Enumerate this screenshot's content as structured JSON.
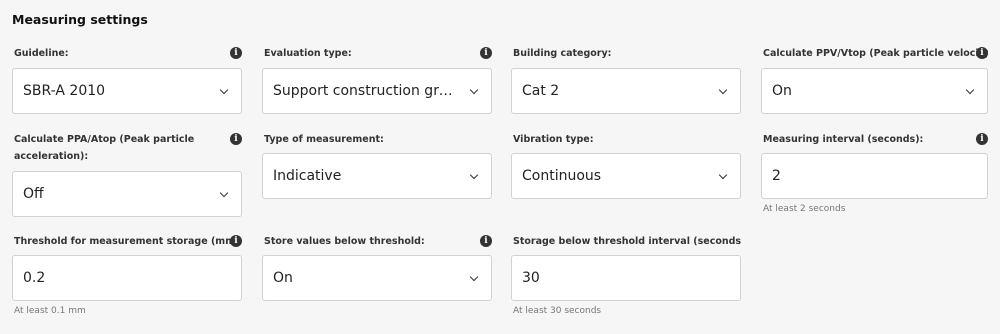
{
  "section_title": "Measuring settings",
  "fields": {
    "guideline": {
      "label": "Guideline:",
      "value": "SBR-A 2010",
      "info": "i"
    },
    "evaluation_type": {
      "label": "Evaluation type:",
      "value": "Support construction gro...",
      "info": "i"
    },
    "building_category": {
      "label": "Building category:",
      "value": "Cat 2"
    },
    "calc_ppv": {
      "label": "Calculate PPV/Vtop (Peak particle velocity",
      "value": "On",
      "info": "i"
    },
    "calc_ppa": {
      "label": "Calculate PPA/Atop (Peak particle acceleration):",
      "value": "Off",
      "info": "i"
    },
    "type_of_measurement": {
      "label": "Type of measurement:",
      "value": "Indicative"
    },
    "vibration_type": {
      "label": "Vibration type:",
      "value": "Continuous"
    },
    "measuring_interval": {
      "label": "Measuring interval (seconds):",
      "value": "2",
      "hint": "At least 2 seconds",
      "info": "i"
    },
    "threshold_storage": {
      "label": "Threshold for measurement storage (mm/",
      "value": "0.2",
      "hint": "At least 0.1 mm",
      "info": "i"
    },
    "store_below": {
      "label": "Store values below threshold:",
      "value": "On",
      "info": "i"
    },
    "storage_interval": {
      "label": "Storage below threshold interval (seconds):",
      "value": "30",
      "hint": "At least 30 seconds"
    }
  }
}
